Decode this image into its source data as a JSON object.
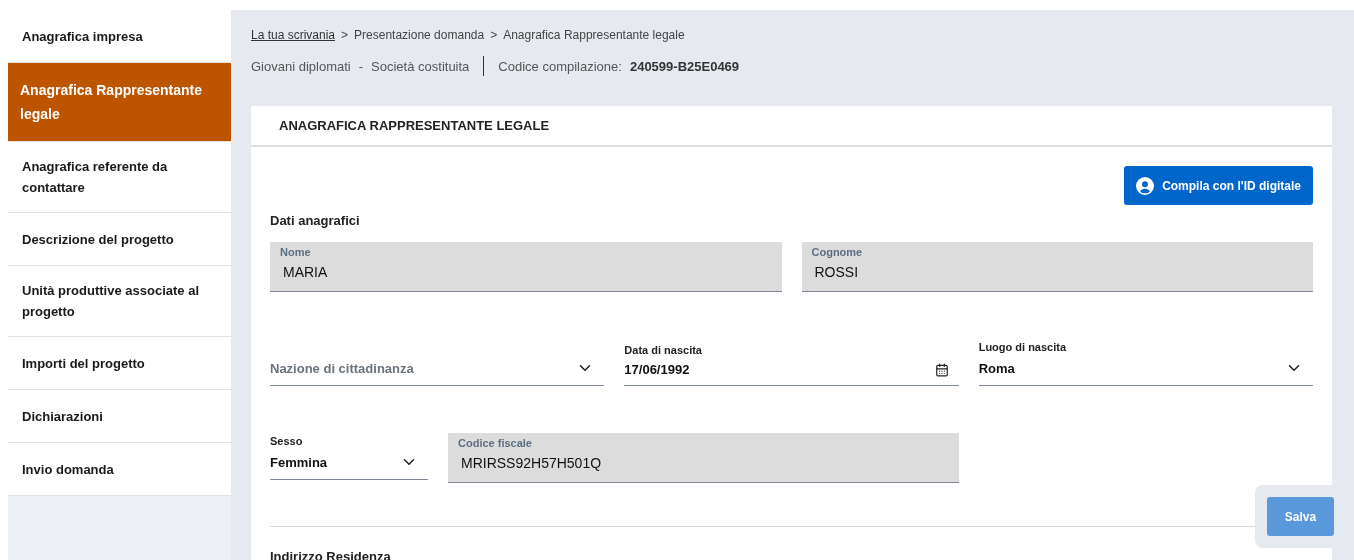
{
  "sidebar": {
    "items": [
      {
        "label": "Anagrafica impresa",
        "selected": false
      },
      {
        "label": "Anagrafica Rappresentante legale",
        "selected": true
      },
      {
        "label": "Anagrafica referente da contattare",
        "selected": false
      },
      {
        "label": "Descrizione del progetto",
        "selected": false
      },
      {
        "label": "Unità produttive associate al progetto",
        "selected": false
      },
      {
        "label": "Importi del progetto",
        "selected": false
      },
      {
        "label": "Dichiarazioni",
        "selected": false
      },
      {
        "label": "Invio domanda",
        "selected": false
      }
    ]
  },
  "breadcrumb": [
    {
      "label": "La tua scrivania",
      "kind": "link"
    },
    {
      "label": "Presentazione domanda",
      "kind": "text",
      "separator": ">"
    },
    {
      "label": "Anagrafica Rappresentante legale",
      "kind": "text",
      "separator": ">"
    }
  ],
  "info": {
    "program": "Giovani diplomati",
    "separator": "-",
    "company_type": "Società costituita",
    "code_label": "Codice compilazione:",
    "code": "240599-B25E0469"
  },
  "card": {
    "title": "ANAGRAFICA RAPPRESENTANTE LEGALE",
    "id_button": "Compila con l'ID digitale",
    "section": "Dati anagrafici",
    "rows": [
      [
        {
          "kind": "text",
          "label": "Nome",
          "value": "MARIA",
          "readonly": true
        },
        {
          "kind": "text",
          "label": "Cognome",
          "value": "ROSSI",
          "readonly": true
        }
      ],
      [
        {
          "kind": "select",
          "placeholder": "Nazione di cittadinanza",
          "readonly": false
        },
        {
          "kind": "date",
          "label": "Data di nascita",
          "value": "17/06/1992",
          "readonly": false
        },
        {
          "kind": "select",
          "label": "Luogo di nascita",
          "value": "Roma",
          "readonly": false
        }
      ],
      [
        {
          "kind": "select",
          "label": "Sesso",
          "value": "Femmina",
          "readonly": false
        },
        {
          "kind": "text",
          "label": "Codice fiscale",
          "value": "MRIRSS92H57H501Q",
          "readonly": true
        }
      ]
    ],
    "next_section": "Indirizzo Residenza"
  },
  "save_button": "Salva"
}
